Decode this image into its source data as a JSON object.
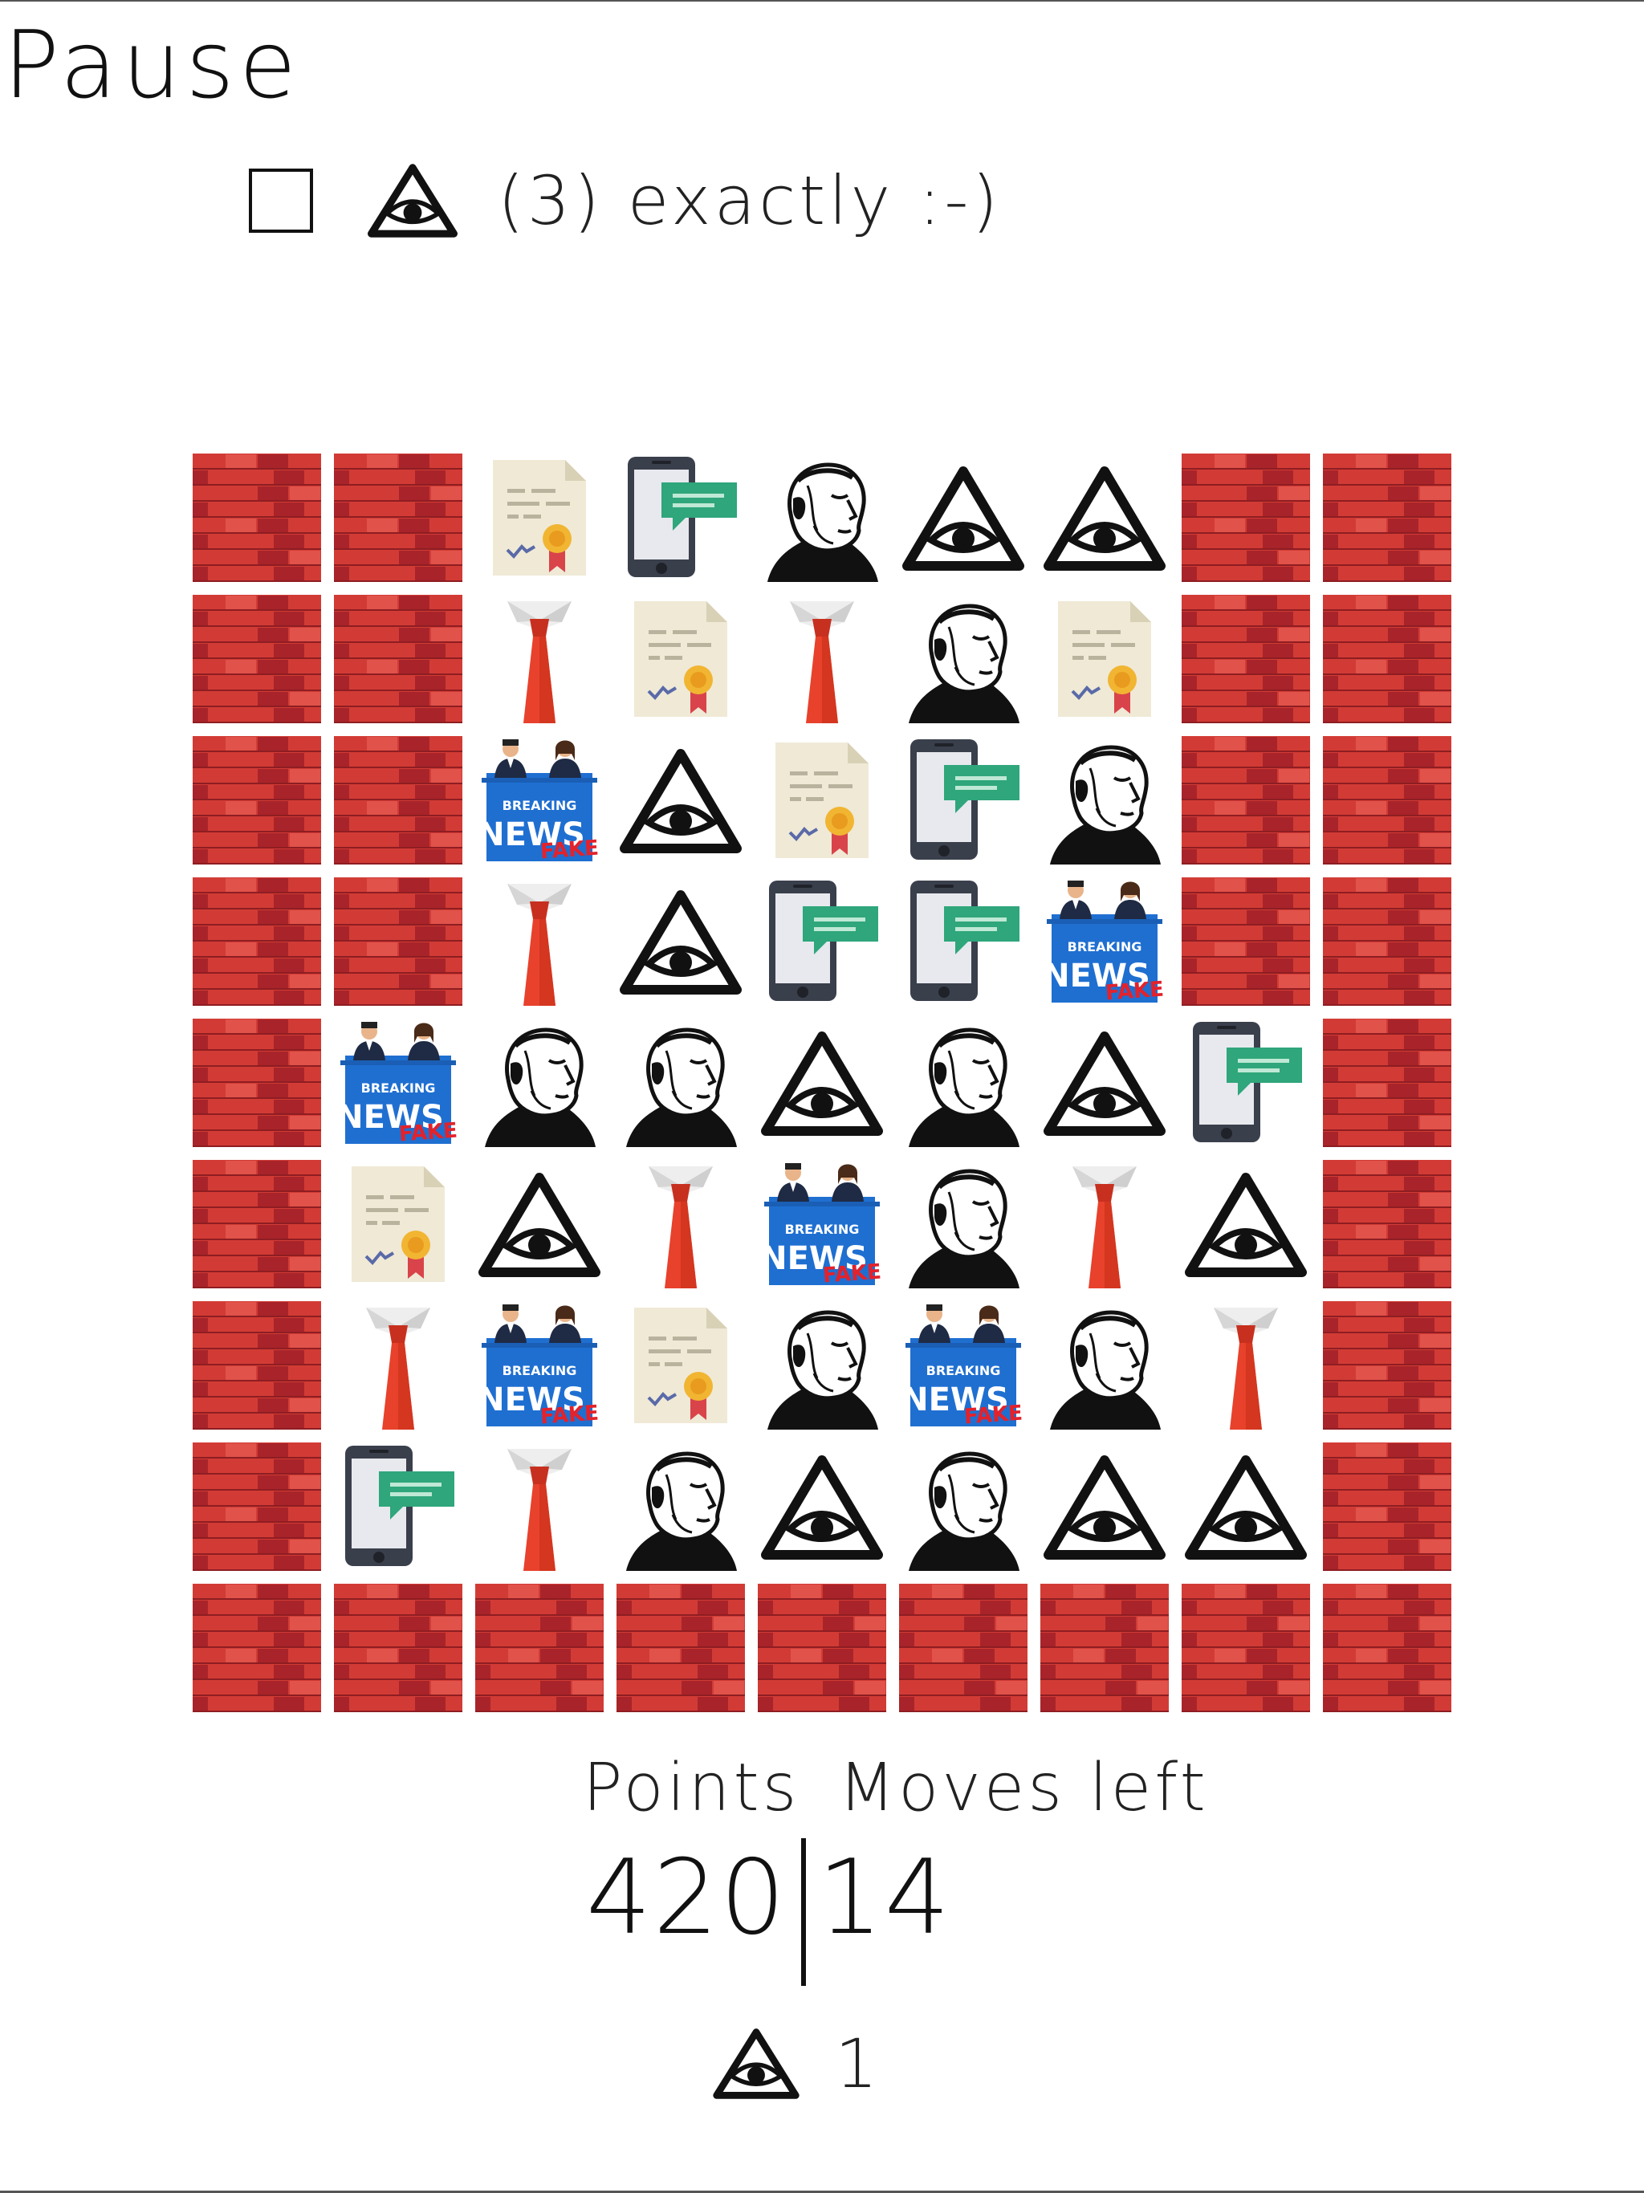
{
  "pause_label": "Pause",
  "objective": {
    "checked": false,
    "icon": "eye-pyramid-icon",
    "text": "(3) exactly :-)"
  },
  "stats": {
    "points_label": "Points",
    "moves_label": "Moves left",
    "points": "420",
    "moves": "14"
  },
  "bonus": {
    "icon": "eye-pyramid-icon",
    "count": "1"
  },
  "colors": {
    "brick": "#d23b35",
    "brick_dark": "#a8242a",
    "news_blue": "#1f6fd1",
    "fake_red": "#e3222b",
    "message_green": "#2fa67b",
    "tie_red": "#e8412c"
  },
  "legend": {
    "B": "brick-wall-tile",
    "D": "certificate-document-tile",
    "M": "phone-message-tile",
    "P": "portrait-profile-tile",
    "E": "eye-pyramid-tile",
    "T": "tie-tile",
    "N": "fake-news-tile"
  },
  "board": [
    [
      "B",
      "B",
      "D",
      "M",
      "P",
      "E",
      "E",
      "B",
      "B"
    ],
    [
      "B",
      "B",
      "T",
      "D",
      "T",
      "P",
      "D",
      "B",
      "B"
    ],
    [
      "B",
      "B",
      "N",
      "E",
      "D",
      "M",
      "P",
      "B",
      "B"
    ],
    [
      "B",
      "B",
      "T",
      "E",
      "M",
      "M",
      "N",
      "B",
      "B"
    ],
    [
      "B",
      "N",
      "P",
      "P",
      "E",
      "P",
      "E",
      "M",
      "B"
    ],
    [
      "B",
      "D",
      "E",
      "T",
      "N",
      "P",
      "T",
      "E",
      "B"
    ],
    [
      "B",
      "T",
      "N",
      "D",
      "P",
      "N",
      "P",
      "T",
      "B"
    ],
    [
      "B",
      "M",
      "T",
      "P",
      "E",
      "P",
      "E",
      "E",
      "B"
    ],
    [
      "B",
      "B",
      "B",
      "B",
      "B",
      "B",
      "B",
      "B",
      "B"
    ]
  ]
}
